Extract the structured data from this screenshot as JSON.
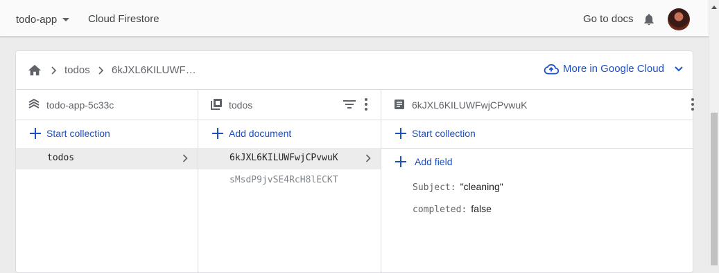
{
  "topbar": {
    "project": "todo-app",
    "product": "Cloud Firestore",
    "docs_link": "Go to docs"
  },
  "breadcrumb": {
    "items": [
      "todos",
      "6kJXL6KILUWF…"
    ],
    "more_link": "More in Google Cloud"
  },
  "columns": {
    "root": {
      "title": "todo-app-5c33c",
      "action": "Start collection",
      "items": [
        "todos"
      ]
    },
    "collection": {
      "title": "todos",
      "action": "Add document",
      "items": [
        "6kJXL6KILUWFwjCPvwuK",
        "sMsdP9jvSE4RcH8lECKT"
      ]
    },
    "document": {
      "title": "6kJXL6KILUWFwjCPvwuK",
      "action": "Start collection",
      "add_field": "Add field",
      "fields": [
        {
          "key": "Subject:",
          "value": "\"cleaning\""
        },
        {
          "key": "completed:",
          "value": "false"
        }
      ]
    }
  },
  "colors": {
    "accent": "#1a4fc6",
    "selected_row": "#ececec"
  }
}
